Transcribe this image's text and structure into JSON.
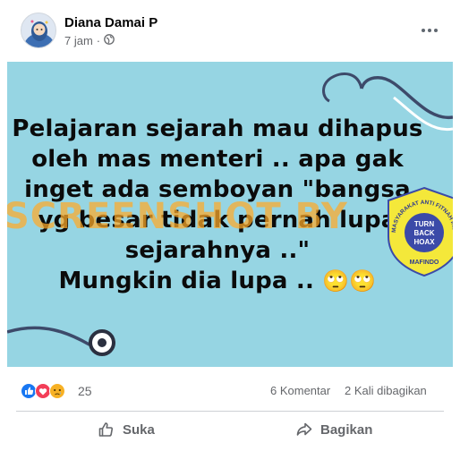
{
  "post": {
    "author": "Diana Damai P",
    "time": "7 jam",
    "privacy_icon": "globe-icon"
  },
  "image": {
    "text_lines": [
      "Pelajaran sejarah mau dihapus",
      "oleh mas menteri .. apa gak",
      "inget ada semboyan \"bangsa",
      "yg besar tidak pernah lupa",
      "sejarahnya ..\"",
      "Mungkin dia lupa .."
    ],
    "emoji": "🙄🙄",
    "watermark": "SCREENSHOT BY",
    "badge": {
      "arc_text": "MASYARAKAT ANTI FITNAH INDONESIA",
      "line1": "TURN",
      "line2": "BACK",
      "line3": "HOAX",
      "bottom": "MAFINDO"
    },
    "colors": {
      "background": "#96d5e3",
      "stethoscope": "#3d4a6a"
    }
  },
  "stats": {
    "reactions_count": "25",
    "comments": "6 Komentar",
    "shares": "2 Kali dibagikan"
  },
  "actions": {
    "like": "Suka",
    "share": "Bagikan"
  }
}
